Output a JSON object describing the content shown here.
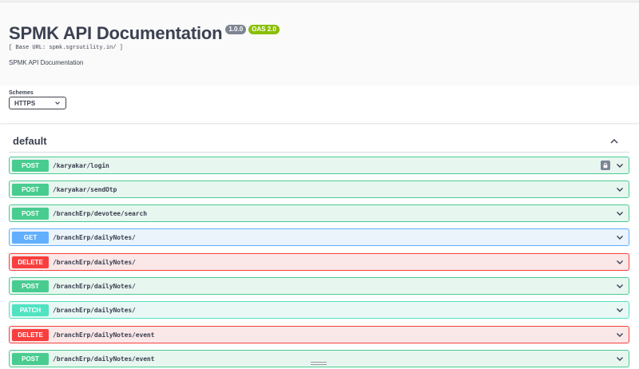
{
  "info": {
    "title": "SPMK API Documentation",
    "version": "1.0.0",
    "oas_badge": "OAS 2.0",
    "base_url": "[ Base URL: spmk.sgrsutility.in/ ]",
    "description": "SPMK API Documentation"
  },
  "schemes": {
    "label": "Schemes",
    "selected": "HTTPS"
  },
  "section": {
    "title": "default",
    "toggle_icon": "chevron-up-icon"
  },
  "operations": [
    {
      "method": "POST",
      "path": "/karyakar/login",
      "has_lock": true
    },
    {
      "method": "POST",
      "path": "/karyakar/sendOtp"
    },
    {
      "method": "POST",
      "path": "/branchErp/devotee/search"
    },
    {
      "method": "GET",
      "path": "/branchErp/dailyNotes/"
    },
    {
      "method": "DELETE",
      "path": "/branchErp/dailyNotes/"
    },
    {
      "method": "POST",
      "path": "/branchErp/dailyNotes/"
    },
    {
      "method": "PATCH",
      "path": "/branchErp/dailyNotes/"
    },
    {
      "method": "DELETE",
      "path": "/branchErp/dailyNotes/event"
    },
    {
      "method": "POST",
      "path": "/branchErp/dailyNotes/event"
    }
  ],
  "colors": {
    "post": "#49cc90",
    "get": "#61affe",
    "delete": "#f93e3e",
    "patch": "#50e3c2",
    "version_badge": "#7d8492",
    "oas_badge": "#89bf04"
  }
}
